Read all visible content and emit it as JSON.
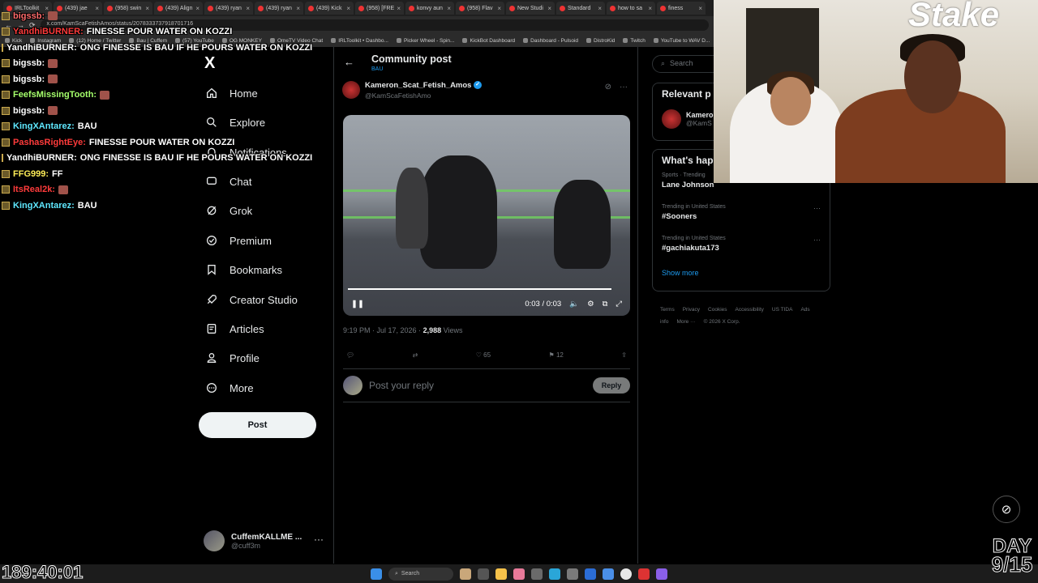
{
  "browser": {
    "tabs": [
      "IRLToolkit",
      "(439) jae",
      "(958) swin",
      "(439) Align",
      "(439) ryan",
      "(439) ryan",
      "(439) Kick",
      "(958) [FRE",
      "konvy aun",
      "(958) Flav",
      "New Studi",
      "Standard",
      "how to sa",
      "finess"
    ],
    "url": "x.com/KamScaFetishAmos/status/2078333737918701716",
    "bookmarks": [
      "Kick",
      "Instagram",
      "(12) Home / Twitter",
      "Bau | Cuffem",
      "(57) YouTube",
      "OG MONKEY",
      "OmeTV Video Chat",
      "IRLToolkit • Dashbo...",
      "Picker Wheel - Spin...",
      "KickBot Dashboard",
      "Dashboard - Pulsoid",
      "DistroKid",
      "Twitch",
      "YouTube to WAV D..."
    ]
  },
  "chat": [
    {
      "user": "bigssb:",
      "color": "#ff6b6b",
      "text": ""
    },
    {
      "user": "YandhiBURNER:",
      "color": "#ff3b3b",
      "text": "FINESSE POUR WATER ON KOZZI"
    },
    {
      "user": "YandhiBURNER:",
      "color": "#ffffff",
      "text": "ONG FINESSE IS BAU IF HE POURS WATER ON KOZZI"
    },
    {
      "user": "bigssb:",
      "color": "#ffffff",
      "text": ""
    },
    {
      "user": "bigssb:",
      "color": "#ffffff",
      "text": ""
    },
    {
      "user": "FeefsMissingTooth:",
      "color": "#a5ff6b",
      "text": ""
    },
    {
      "user": "bigssb:",
      "color": "#ffffff",
      "text": ""
    },
    {
      "user": "KingXAntarez:",
      "color": "#5fe8ff",
      "text": "BAU"
    },
    {
      "user": "PashasRightEye:",
      "color": "#ff3b3b",
      "text": "FINESSE POUR WATER ON KOZZI"
    },
    {
      "user": "YandhiBURNER:",
      "color": "#ffffff",
      "text": "ONG FINESSE IS BAU IF HE POURS WATER ON KOZZI"
    },
    {
      "user": "FFG999:",
      "color": "#ffee58",
      "text": "FF"
    },
    {
      "user": "ItsReal2k:",
      "color": "#ff3b3b",
      "text": ""
    },
    {
      "user": "KingXAntarez:",
      "color": "#5fe8ff",
      "text": "BAU"
    }
  ],
  "nav": {
    "logo": "X",
    "items": [
      "Home",
      "Explore",
      "Notifications",
      "Chat",
      "Grok",
      "Premium",
      "Bookmarks",
      "Creator Studio",
      "Articles",
      "Profile",
      "More"
    ],
    "post_label": "Post",
    "account_name": "CuffemKALLME ...",
    "account_handle": "@cuff3m"
  },
  "post": {
    "header_title": "Community post",
    "header_sub": "BAU",
    "author_name": "Kameron_Scat_Fetish_Amos",
    "author_handle": "@KamScaFetishAmo",
    "video_time": "0:03 / 0:03",
    "video_progress": 1.0,
    "timestamp": "9:19 PM · Jul 17, 2026 ·",
    "views": "2,988",
    "views_label": "Views",
    "likes": "65",
    "bookmarks": "12",
    "reply_placeholder": "Post your reply",
    "reply_button": "Reply"
  },
  "sidebar": {
    "search_placeholder": "Search",
    "relevant_title": "Relevant p",
    "relevant_name": "Kamero",
    "relevant_handle": "@KamS",
    "happening_title": "What's hap",
    "trends": [
      {
        "context": "Sports · Trending",
        "name": "Lane Johnson"
      },
      {
        "context": "Trending in United States",
        "name": "#Sooners"
      },
      {
        "context": "Trending in United States",
        "name": "#gachiakuta173"
      }
    ],
    "show_more": "Show more",
    "footer": [
      "Terms",
      "Privacy",
      "Cookies",
      "Accessibility",
      "US TIDA",
      "Ads info",
      "More ···",
      "© 2026 X Corp."
    ]
  },
  "overlay": {
    "timer": "189:40:01",
    "day_label": "DAY",
    "day_value": "9/15",
    "webcam_sign": "Stake"
  },
  "taskbar": {
    "search_label": "Search"
  }
}
